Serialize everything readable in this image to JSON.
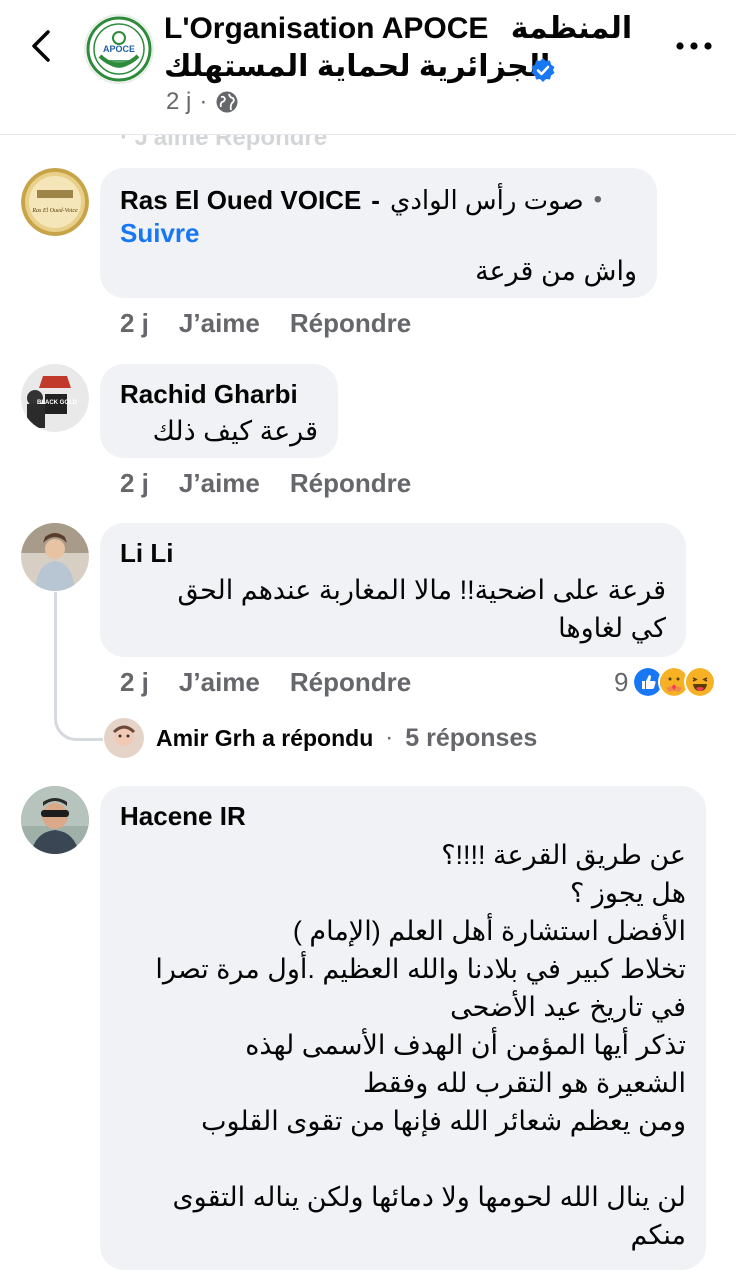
{
  "header": {
    "title_line1_latin": "L'Organisation APOCE",
    "title_line1_arabic": "المنظمة",
    "title_line2": "الجزائرية لحماية المستهلك",
    "time": "2 j",
    "logo_text": "APOCE"
  },
  "ghost_row": "· J'aime   Répondre",
  "comments": [
    {
      "author": "Ras El Oued VOICE",
      "author_arabic": "صوت رأس الوادي",
      "author_sep": "-",
      "follow": "Suivre",
      "text": "واش من قرعة",
      "time": "2 j",
      "like": "J’aime",
      "reply": "Répondre",
      "avatar_text": "Ras El Oued-Voice"
    },
    {
      "author": "Rachid Gharbi",
      "text": "قرعة كيف ذلك",
      "time": "2 j",
      "like": "J’aime",
      "reply": "Répondre",
      "avatar_text": "BLACK GOLD"
    },
    {
      "author": "Li Li",
      "text_line1": "قرعة على اضحية!!  مالا المغاربة عندهم الحق",
      "text_line2": "كي لغاوها",
      "time": "2 j",
      "like": "J’aime",
      "reply": "Répondre",
      "reaction_count": "9",
      "reply_author": "Amir Grh",
      "reply_verb": "a répondu",
      "reply_sep": "·",
      "reply_count": "5 réponses"
    },
    {
      "author": "Hacene IR",
      "lines": [
        "عن طريق القرعة !!!!؟",
        "هل يجوز ؟",
        "الأفضل استشارة أهل العلم (الإمام )",
        "تخلاط كبير في بلادنا والله العظيم .أول مرة تصرا",
        "في تاريخ عيد الأضحى",
        "تذكر أيها المؤمن أن الهدف الأسمى لهذه",
        "الشعيرة هو التقرب لله وفقط",
        "ومن يعظم شعائر الله فإنها من تقوى القلوب",
        "",
        "لن ينال الله لحومها ولا دمائها ولكن يناله التقوى",
        "منكم"
      ]
    }
  ],
  "colors": {
    "link": "#1877f2",
    "muted": "#65676b",
    "bubble": "#f0f2f5",
    "verified": "#1877f2",
    "like_reaction": "#1877f2",
    "care_reaction": "#f7b125",
    "haha_reaction": "#f7b125"
  },
  "icons": [
    "back-arrow-icon",
    "verified-badge-icon",
    "globe-icon",
    "more-options-icon",
    "like-reaction-icon",
    "care-reaction-icon",
    "haha-reaction-icon"
  ]
}
